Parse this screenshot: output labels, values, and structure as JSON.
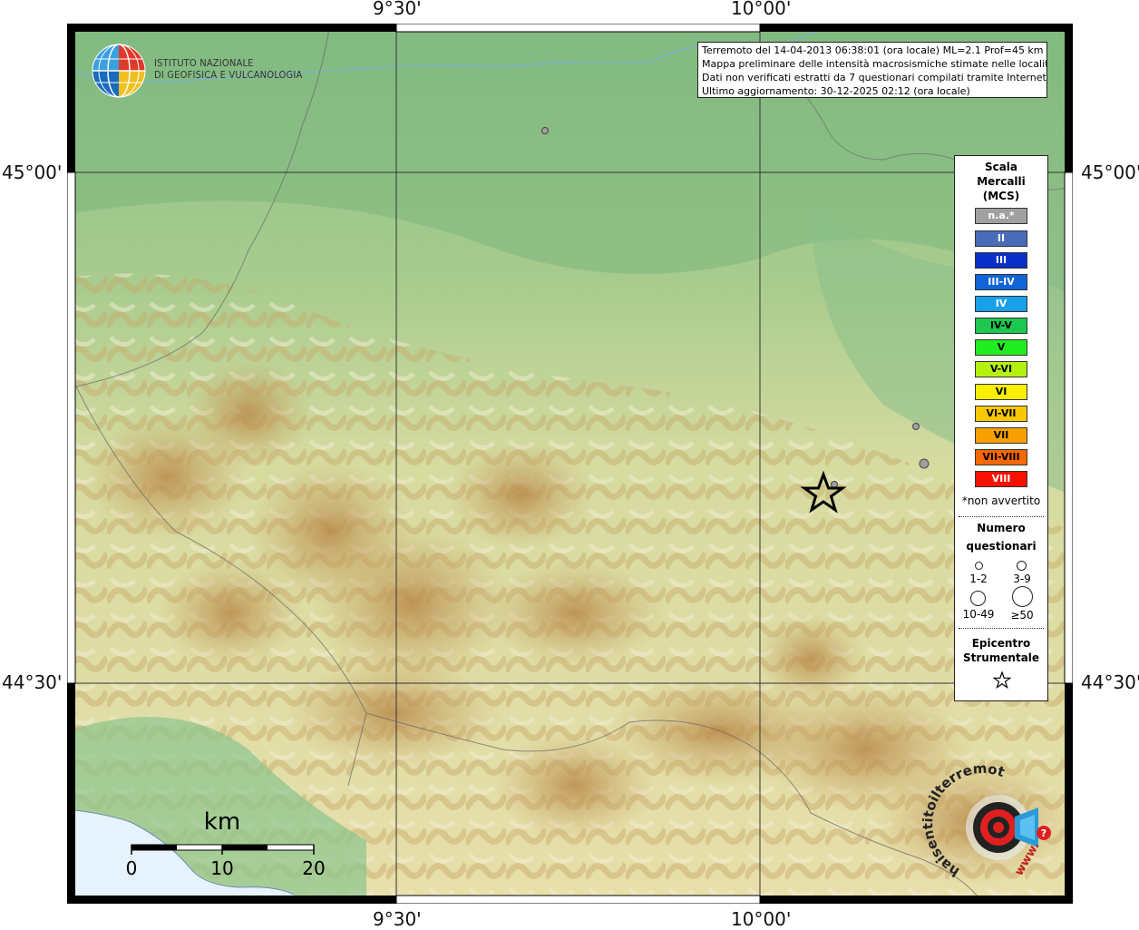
{
  "coordinates": {
    "top": [
      "9°30'",
      "10°00'"
    ],
    "bottom": [
      "9°30'",
      "10°00'"
    ],
    "left": [
      "45°00'",
      "44°30'"
    ],
    "right": [
      "45°00'",
      "44°30'"
    ]
  },
  "institute": {
    "line1": "ISTITUTO NAZIONALE",
    "line2": "DI GEOFISICA E VULCANOLOGIA"
  },
  "info": {
    "line1": "Terremoto del 14-04-2013 06:38:01 (ora locale) ML=2.1 Prof=45 km",
    "line2": "Mappa preliminare delle intensità macrosismiche stimate nelle località",
    "line3": "Dati non verificati estratti da 7 questionari compilati tramite Internet.",
    "line4": "Ultimo aggiornamento: 30-12-2025 02:12 (ora locale)"
  },
  "legend": {
    "title1": "Scala",
    "title2": "Mercalli",
    "title3": "(MCS)",
    "intensities": [
      {
        "label": "n.a.*",
        "color": "#a0a0a0",
        "text": "#ffffff"
      },
      {
        "label": "II",
        "color": "#4a6cb8",
        "text": "#ffffff"
      },
      {
        "label": "III",
        "color": "#0a2fc8",
        "text": "#ffffff"
      },
      {
        "label": "III-IV",
        "color": "#1064d8",
        "text": "#ffffff"
      },
      {
        "label": "IV",
        "color": "#18a0e8",
        "text": "#ffffff"
      },
      {
        "label": "IV-V",
        "color": "#1cc850",
        "text": "#000000"
      },
      {
        "label": "V",
        "color": "#20ee20",
        "text": "#000000"
      },
      {
        "label": "V-VI",
        "color": "#b4f010",
        "text": "#000000"
      },
      {
        "label": "VI",
        "color": "#f8f000",
        "text": "#000000"
      },
      {
        "label": "VI-VII",
        "color": "#f8c800",
        "text": "#000000"
      },
      {
        "label": "VII",
        "color": "#f8a000",
        "text": "#000000"
      },
      {
        "label": "VII-VIII",
        "color": "#f86800",
        "text": "#000000"
      },
      {
        "label": "VIII",
        "color": "#f81000",
        "text": "#ffffff"
      }
    ],
    "not_felt": "*non avvertito",
    "questionnaires_title1": "Numero",
    "questionnaires_title2": "questionari",
    "sizes": [
      "1-2",
      "3-9",
      "10-49",
      "≥50"
    ],
    "epicenter1": "Epicentro",
    "epicenter2": "Strumentale"
  },
  "scale_bar": {
    "unit": "km",
    "ticks": [
      "0",
      "10",
      "20"
    ]
  },
  "brand": {
    "arc_text": "haisentitoilterremoto.it",
    "www": "www."
  }
}
